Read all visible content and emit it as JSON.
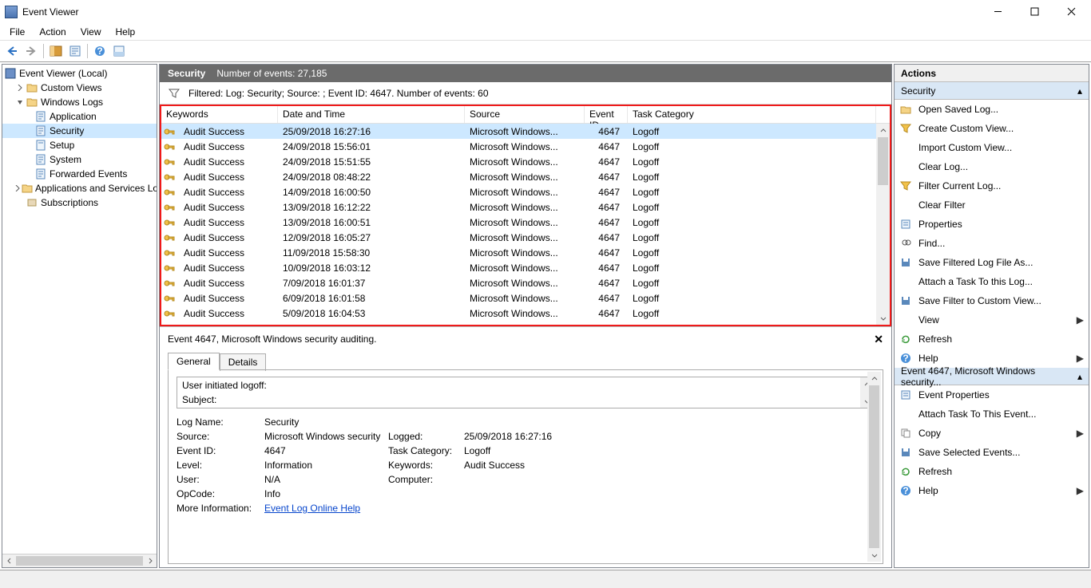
{
  "titlebar": {
    "title": "Event Viewer"
  },
  "menu": [
    "File",
    "Action",
    "View",
    "Help"
  ],
  "tree": {
    "root": "Event Viewer (Local)",
    "custom_views": "Custom Views",
    "windows_logs": "Windows Logs",
    "wl_children": [
      "Application",
      "Security",
      "Setup",
      "System",
      "Forwarded Events"
    ],
    "apps_services": "Applications and Services Logs",
    "subscriptions": "Subscriptions"
  },
  "center": {
    "heading": "Security",
    "num_events_label": "Number of events: 27,185",
    "filter_text": "Filtered: Log: Security; Source: ; Event ID: 4647. Number of events: 60",
    "columns": {
      "keywords": "Keywords",
      "datetime": "Date and Time",
      "source": "Source",
      "eventid": "Event ID",
      "taskcat": "Task Category"
    },
    "rows": [
      {
        "k": "Audit Success",
        "d": "25/09/2018 16:27:16",
        "s": "Microsoft Windows...",
        "e": "4647",
        "t": "Logoff"
      },
      {
        "k": "Audit Success",
        "d": "24/09/2018 15:56:01",
        "s": "Microsoft Windows...",
        "e": "4647",
        "t": "Logoff"
      },
      {
        "k": "Audit Success",
        "d": "24/09/2018 15:51:55",
        "s": "Microsoft Windows...",
        "e": "4647",
        "t": "Logoff"
      },
      {
        "k": "Audit Success",
        "d": "24/09/2018 08:48:22",
        "s": "Microsoft Windows...",
        "e": "4647",
        "t": "Logoff"
      },
      {
        "k": "Audit Success",
        "d": "14/09/2018 16:00:50",
        "s": "Microsoft Windows...",
        "e": "4647",
        "t": "Logoff"
      },
      {
        "k": "Audit Success",
        "d": "13/09/2018 16:12:22",
        "s": "Microsoft Windows...",
        "e": "4647",
        "t": "Logoff"
      },
      {
        "k": "Audit Success",
        "d": "13/09/2018 16:00:51",
        "s": "Microsoft Windows...",
        "e": "4647",
        "t": "Logoff"
      },
      {
        "k": "Audit Success",
        "d": "12/09/2018 16:05:27",
        "s": "Microsoft Windows...",
        "e": "4647",
        "t": "Logoff"
      },
      {
        "k": "Audit Success",
        "d": "11/09/2018 15:58:30",
        "s": "Microsoft Windows...",
        "e": "4647",
        "t": "Logoff"
      },
      {
        "k": "Audit Success",
        "d": "10/09/2018 16:03:12",
        "s": "Microsoft Windows...",
        "e": "4647",
        "t": "Logoff"
      },
      {
        "k": "Audit Success",
        "d": "7/09/2018 16:01:37",
        "s": "Microsoft Windows...",
        "e": "4647",
        "t": "Logoff"
      },
      {
        "k": "Audit Success",
        "d": "6/09/2018 16:01:58",
        "s": "Microsoft Windows...",
        "e": "4647",
        "t": "Logoff"
      },
      {
        "k": "Audit Success",
        "d": "5/09/2018 16:04:53",
        "s": "Microsoft Windows...",
        "e": "4647",
        "t": "Logoff"
      }
    ]
  },
  "detail": {
    "title": "Event 4647, Microsoft Windows security auditing.",
    "tab_general": "General",
    "tab_details": "Details",
    "msg_line1": "User initiated logoff:",
    "msg_line2": "Subject:",
    "fields": {
      "logname_l": "Log Name:",
      "logname_v": "Security",
      "source_l": "Source:",
      "source_v": "Microsoft Windows security",
      "logged_l": "Logged:",
      "logged_v": "25/09/2018 16:27:16",
      "eventid_l": "Event ID:",
      "eventid_v": "4647",
      "taskcat_l": "Task Category:",
      "taskcat_v": "Logoff",
      "level_l": "Level:",
      "level_v": "Information",
      "keywords_l": "Keywords:",
      "keywords_v": "Audit Success",
      "user_l": "User:",
      "user_v": "N/A",
      "computer_l": "Computer:",
      "opcode_l": "OpCode:",
      "opcode_v": "Info",
      "more_l": "More Information:",
      "more_link": "Event Log Online Help"
    }
  },
  "actions": {
    "header": "Actions",
    "sec1": "Security",
    "items1": [
      "Open Saved Log...",
      "Create Custom View...",
      "Import Custom View...",
      "Clear Log...",
      "Filter Current Log...",
      "Clear Filter",
      "Properties",
      "Find...",
      "Save Filtered Log File As...",
      "Attach a Task To this Log...",
      "Save Filter to Custom View...",
      "View",
      "Refresh",
      "Help"
    ],
    "sec2": "Event 4647, Microsoft Windows security...",
    "items2": [
      "Event Properties",
      "Attach Task To This Event...",
      "Copy",
      "Save Selected Events...",
      "Refresh",
      "Help"
    ]
  }
}
